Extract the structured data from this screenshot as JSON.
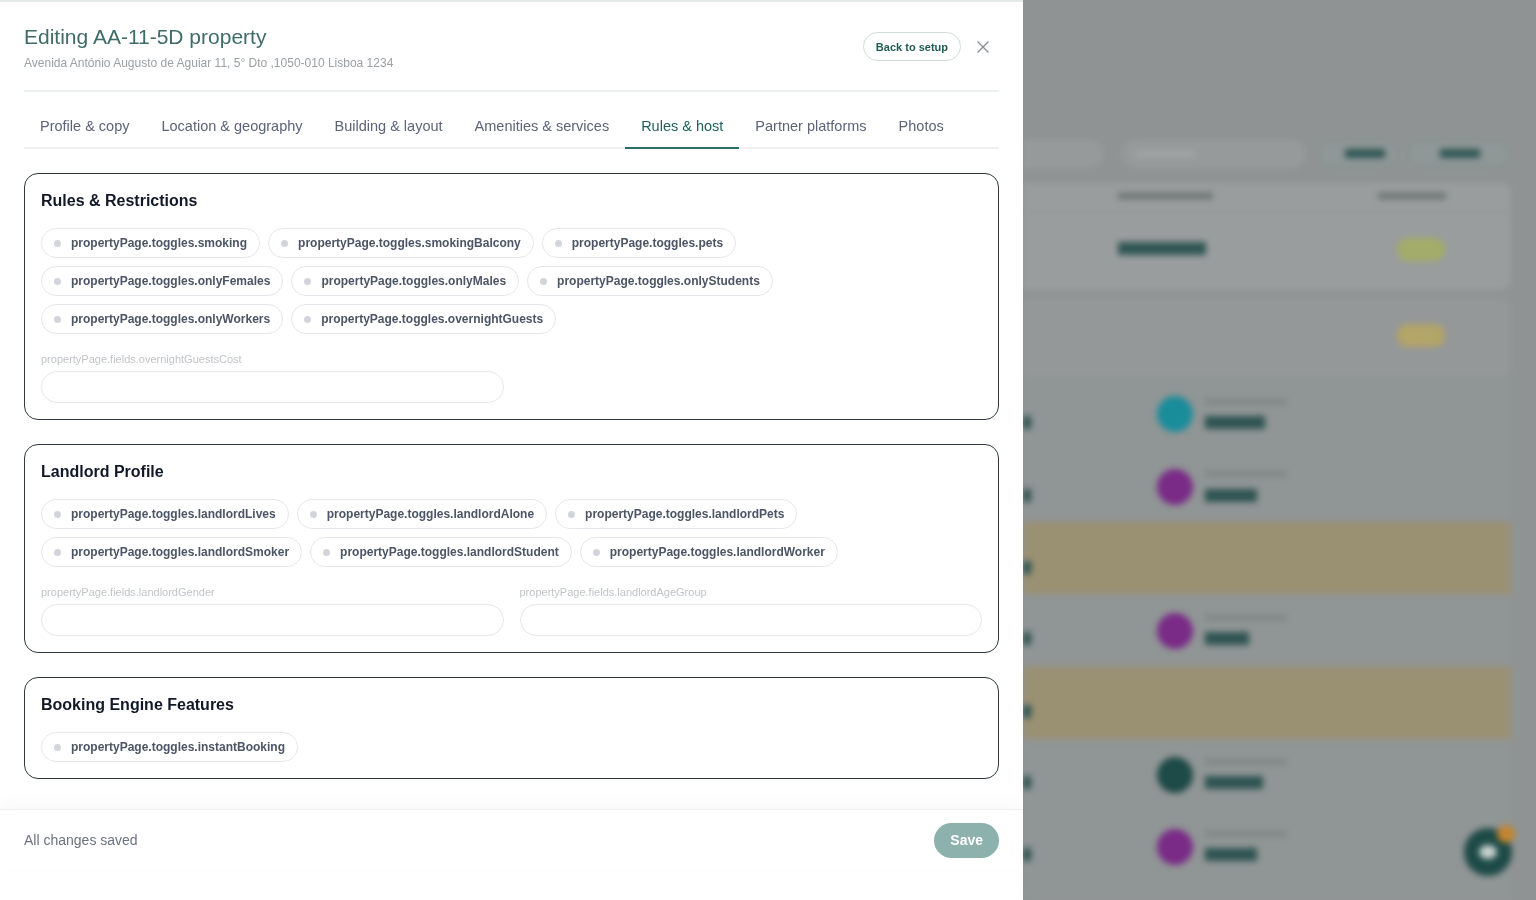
{
  "header": {
    "title": "Editing AA-11-5D property",
    "address": "Avenida António Augusto de Aguiar 11, 5° Dto ,1050-010 Lisboa 1234",
    "back_button": "Back to setup"
  },
  "tabs": [
    {
      "label": "Profile & copy",
      "selected": false
    },
    {
      "label": "Location & geography",
      "selected": false
    },
    {
      "label": "Building & layout",
      "selected": false
    },
    {
      "label": "Amenities & services",
      "selected": false
    },
    {
      "label": "Rules & host",
      "selected": true
    },
    {
      "label": "Partner platforms",
      "selected": false
    },
    {
      "label": "Photos",
      "selected": false
    }
  ],
  "sections": [
    {
      "title": "Rules & Restrictions",
      "toggles": [
        {
          "label": "propertyPage.toggles.smoking",
          "on": false
        },
        {
          "label": "propertyPage.toggles.smokingBalcony",
          "on": false
        },
        {
          "label": "propertyPage.toggles.pets",
          "on": false
        },
        {
          "label": "propertyPage.toggles.onlyFemales",
          "on": false
        },
        {
          "label": "propertyPage.toggles.onlyMales",
          "on": false
        },
        {
          "label": "propertyPage.toggles.onlyStudents",
          "on": false
        },
        {
          "label": "propertyPage.toggles.onlyWorkers",
          "on": false
        },
        {
          "label": "propertyPage.toggles.overnightGuests",
          "on": false
        }
      ],
      "fields": [
        {
          "label": "propertyPage.fields.overnightGuestsCost"
        }
      ]
    },
    {
      "title": "Landlord Profile",
      "toggles": [
        {
          "label": "propertyPage.toggles.landlordLives",
          "on": false
        },
        {
          "label": "propertyPage.toggles.landlordAlone",
          "on": false
        },
        {
          "label": "propertyPage.toggles.landlordPets",
          "on": false
        },
        {
          "label": "propertyPage.toggles.landlordSmoker",
          "on": false
        },
        {
          "label": "propertyPage.toggles.landlordStudent",
          "on": false
        },
        {
          "label": "propertyPage.toggles.landlordWorker",
          "on": false
        }
      ],
      "fields": [
        {
          "label": "propertyPage.fields.landlordGender"
        },
        {
          "label": "propertyPage.fields.landlordAgeGroup"
        }
      ]
    },
    {
      "title": "Booking Engine Features",
      "toggles": [
        {
          "label": "propertyPage.toggles.instantBooking",
          "on": false
        }
      ]
    }
  ],
  "footer": {
    "status": "All changes saved",
    "save_button": {
      "label": "Save",
      "disabled": true
    }
  }
}
